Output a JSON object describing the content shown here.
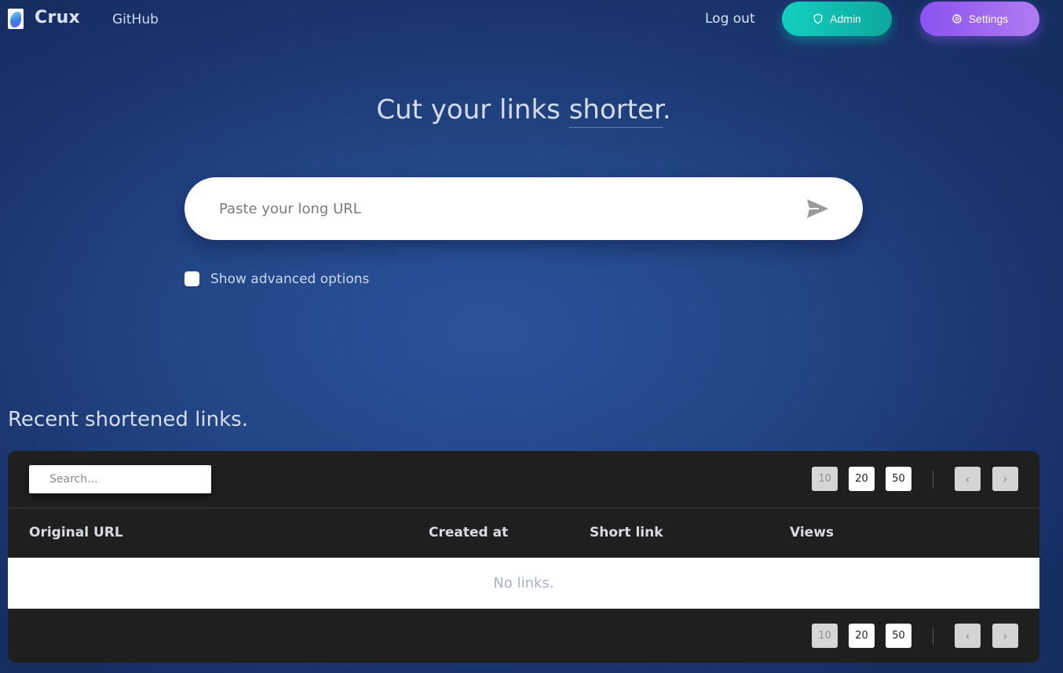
{
  "nav": {
    "brand": "Crux",
    "github": "GitHub",
    "logout": "Log out",
    "admin_label": "Admin",
    "admin_icon": "shield-icon",
    "settings_label": "Settings",
    "settings_icon": "gear-icon",
    "admin_color": "#13cfc0",
    "settings_color": "#8a52f0"
  },
  "hero": {
    "title_start": "Cut your links ",
    "title_emphasis": "shorter",
    "title_end": ".",
    "url_placeholder": "Paste your long URL",
    "url_value": "",
    "send_icon": "send-icon",
    "advanced_label": "Show advanced options",
    "advanced_checked": false
  },
  "recent": {
    "title": "Recent shortened links.",
    "search_placeholder": "Search...",
    "page_sizes": [
      "10",
      "20",
      "50"
    ],
    "active_page_size": "10",
    "prev_label": "‹",
    "next_label": "›",
    "columns": [
      "Original URL",
      "Created at",
      "Short link",
      "Views"
    ],
    "empty_message": "No links."
  }
}
